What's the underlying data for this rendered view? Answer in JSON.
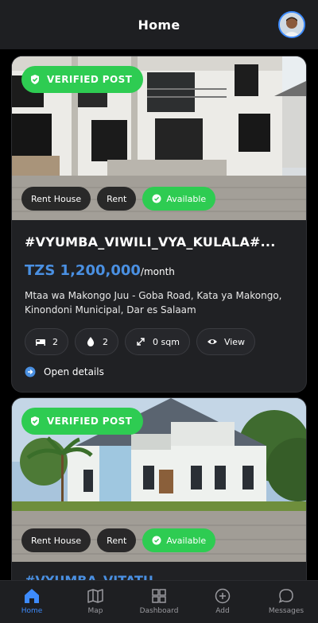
{
  "app_bar": {
    "title": "Home"
  },
  "listings": [
    {
      "badge": "VERIFIED POST",
      "tags": [
        "Rent House",
        "Rent",
        "Available"
      ],
      "title": "#VYUMBA_VIWILI_VYA_KULALA#...",
      "price": "TZS 1,200,000",
      "price_suffix": "/month",
      "address": "Mtaa wa Makongo Juu - Goba Road, Kata ya Makongo, Kinondoni Municipal, Dar es Salaam",
      "stats": {
        "bedrooms": "2",
        "bathrooms": "2",
        "area": "0 sqm",
        "view": "View"
      },
      "open_details": "Open details"
    },
    {
      "badge": "VERIFIED POST",
      "tags": [
        "Rent House",
        "Rent",
        "Available"
      ],
      "title_partial": "#VYUMBA_VITATU"
    }
  ],
  "bottom_nav": [
    {
      "label": "Home",
      "icon": "home-icon",
      "active": true
    },
    {
      "label": "Map",
      "icon": "map-icon",
      "active": false
    },
    {
      "label": "Dashboard",
      "icon": "dashboard-icon",
      "active": false
    },
    {
      "label": "Add",
      "icon": "add-icon",
      "active": false
    },
    {
      "label": "Messages",
      "icon": "messages-icon",
      "active": false
    }
  ],
  "colors": {
    "accent": "#3d8bfd",
    "verified_green": "#2ecc52",
    "price_blue": "#4a90e2",
    "card_bg": "#202124"
  }
}
